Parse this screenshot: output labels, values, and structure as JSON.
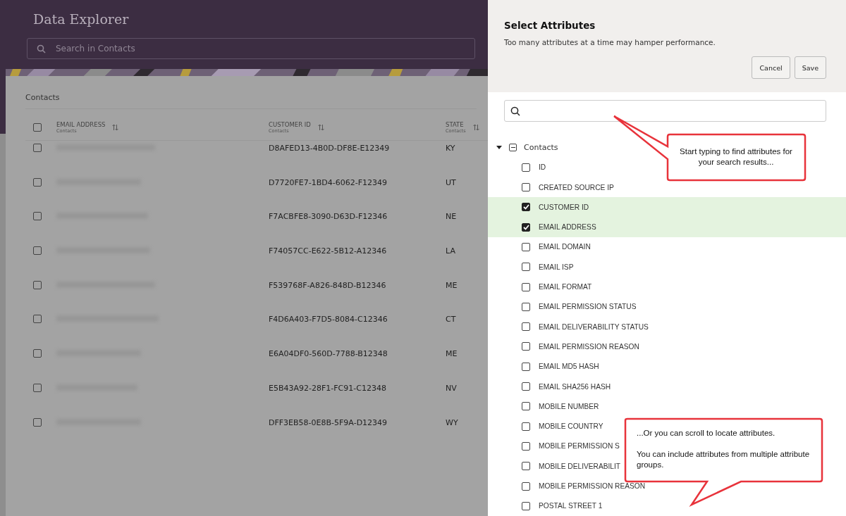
{
  "app": {
    "title": "Data Explorer",
    "search": {
      "placeholder": "Search in Contacts"
    }
  },
  "table": {
    "title": "Contacts",
    "select_all": {
      "checked": false
    },
    "columns": [
      {
        "label": "EMAIL ADDRESS",
        "group": "Contacts"
      },
      {
        "label": "CUSTOMER ID",
        "group": "Contacts"
      },
      {
        "label": "STATE",
        "group": "Contacts"
      }
    ],
    "rows": [
      {
        "checked": false,
        "customer_id": "D8AFED13-4B0D-DF8E-E12349",
        "state": "KY"
      },
      {
        "checked": false,
        "customer_id": "D7720FE7-1BD4-6062-F12349",
        "state": "UT"
      },
      {
        "checked": false,
        "customer_id": "F7ACBFE8-3090-D63D-F12346",
        "state": "NE"
      },
      {
        "checked": false,
        "customer_id": "F74057CC-E622-5B12-A12346",
        "state": "LA"
      },
      {
        "checked": false,
        "customer_id": "F539768F-A826-848D-B12346",
        "state": "ME"
      },
      {
        "checked": false,
        "customer_id": "F4D6A403-F7D5-8084-C12346",
        "state": "CT"
      },
      {
        "checked": false,
        "customer_id": "E6A04DF0-560D-7788-B12348",
        "state": "ME"
      },
      {
        "checked": false,
        "customer_id": "E5B43A92-28F1-FC91-C12348",
        "state": "NV"
      },
      {
        "checked": false,
        "customer_id": "DFF3EB58-0E8B-5F9A-D12349",
        "state": "WY"
      }
    ]
  },
  "panel": {
    "title": "Select Attributes",
    "subtitle": "Too many attributes at a time may hamper performance.",
    "buttons": [
      "Cancel",
      "Save"
    ],
    "tree": [
      {
        "label": "Contacts",
        "expanded": true,
        "partial": true,
        "children": [
          {
            "label": "ID",
            "checked": false
          },
          {
            "label": "CREATED SOURCE IP",
            "checked": false
          },
          {
            "label": "CUSTOMER ID",
            "checked": true
          },
          {
            "label": "EMAIL ADDRESS",
            "checked": true
          },
          {
            "label": "EMAIL DOMAIN",
            "checked": false
          },
          {
            "label": "EMAIL ISP",
            "checked": false
          },
          {
            "label": "EMAIL FORMAT",
            "checked": false
          },
          {
            "label": "EMAIL PERMISSION STATUS",
            "checked": false
          },
          {
            "label": "EMAIL DELIVERABILITY STATUS",
            "checked": false
          },
          {
            "label": "EMAIL PERMISSION REASON",
            "checked": false
          },
          {
            "label": "EMAIL MD5 HASH",
            "checked": false
          },
          {
            "label": "EMAIL SHA256 HASH",
            "checked": false
          },
          {
            "label": "MOBILE NUMBER",
            "checked": false
          },
          {
            "label": "MOBILE COUNTRY",
            "checked": false
          },
          {
            "label": "MOBILE PERMISSION S",
            "checked": false
          },
          {
            "label": "MOBILE DELIVERABILIT",
            "checked": false
          },
          {
            "label": "MOBILE PERMISSION REASON",
            "checked": false
          },
          {
            "label": "POSTAL STREET 1",
            "checked": false
          }
        ]
      }
    ]
  },
  "callouts": [
    {
      "text": "Start typing to find attributes for your search results..."
    },
    {
      "paragraphs": [
        "...Or you can scroll to locate attributes.",
        "You can include attributes from multiple attribute groups."
      ]
    }
  ]
}
